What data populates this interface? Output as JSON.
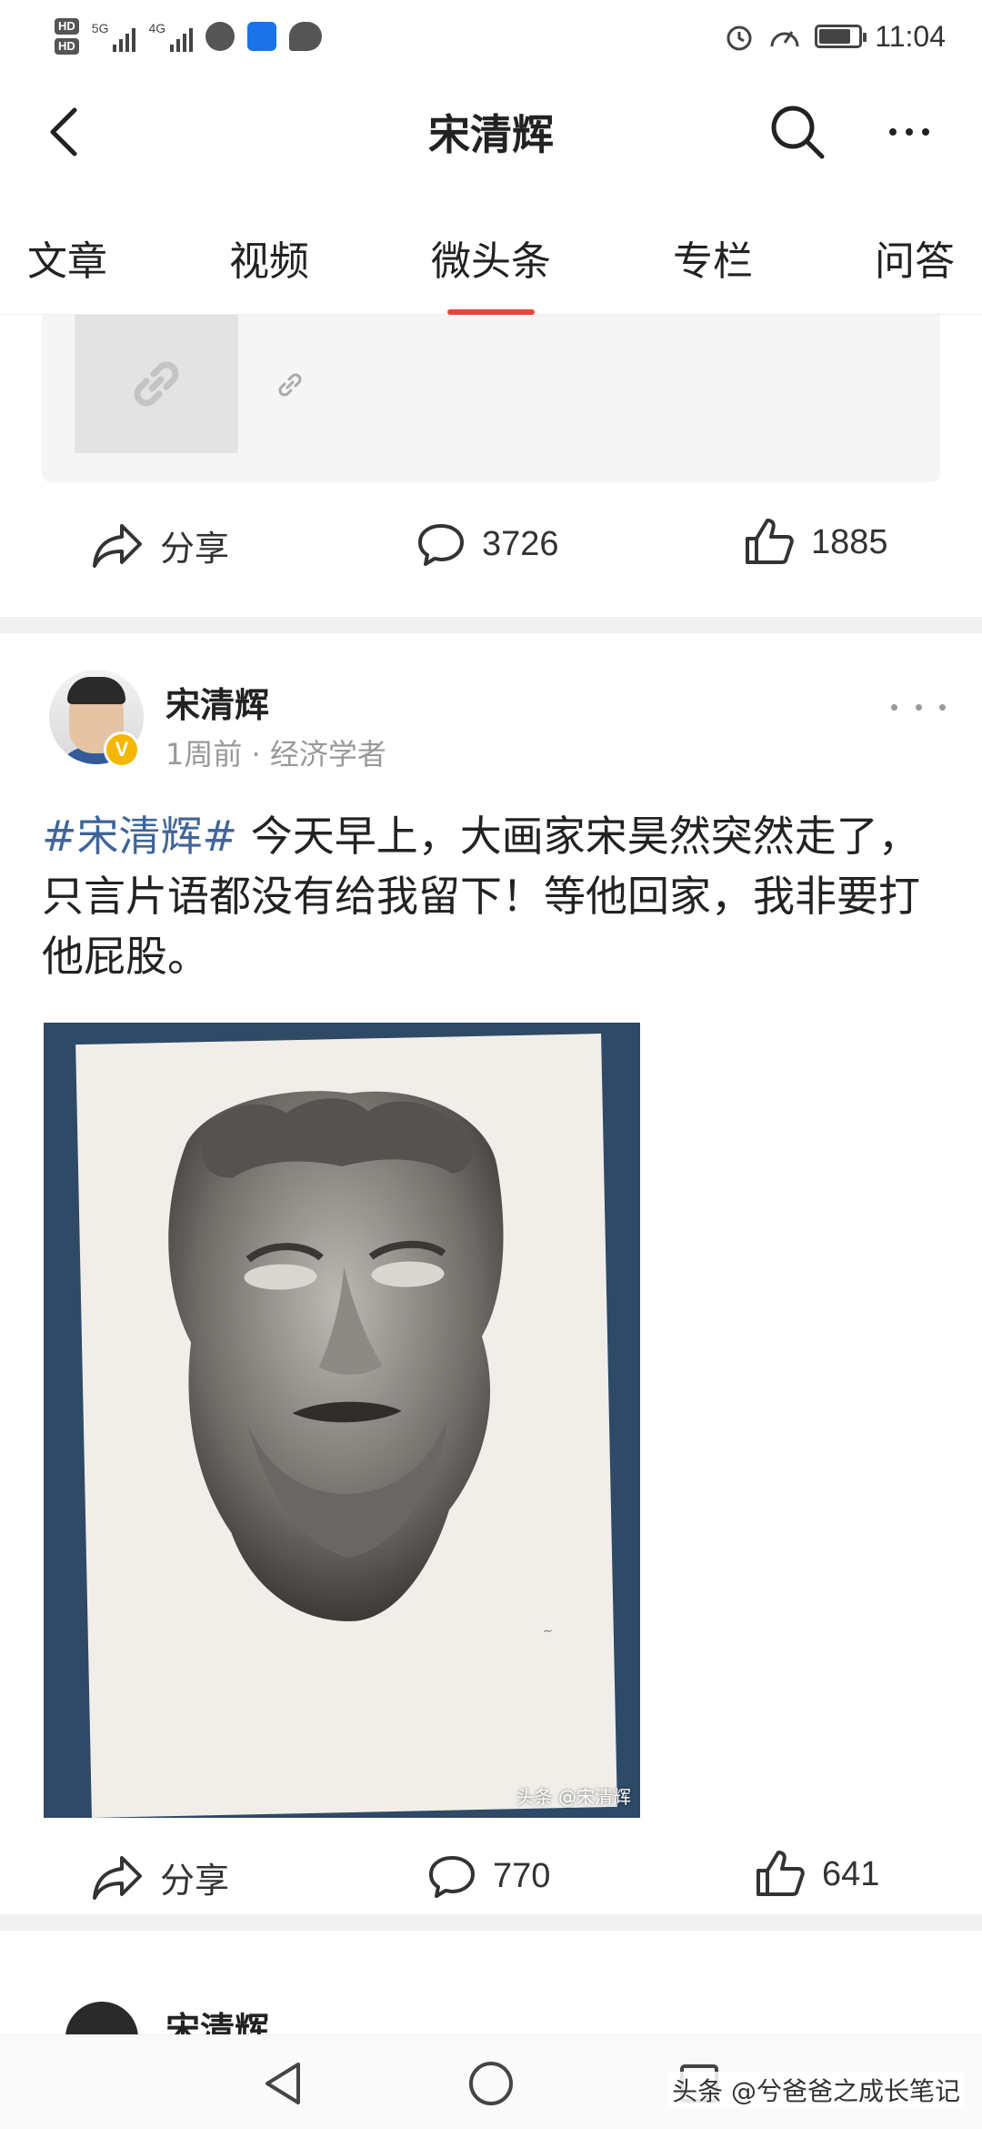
{
  "status_bar": {
    "hd1": "HD",
    "hd2": "HD",
    "net1": "5G",
    "net2": "4G",
    "time": "11:04"
  },
  "header": {
    "title": "宋清辉"
  },
  "tabs": [
    {
      "label": "文章"
    },
    {
      "label": "视频"
    },
    {
      "label": "微头条"
    },
    {
      "label": "专栏"
    },
    {
      "label": "问答"
    }
  ],
  "active_tab": "微头条",
  "prev_post": {
    "share_label": "分享",
    "comments": "3726",
    "likes": "1885"
  },
  "post": {
    "author": "宋清辉",
    "meta": "1周前 · 经济学者",
    "badge": "V",
    "hashtag": "#宋清辉#",
    "text": " 今天早上，大画家宋昊然突然走了，只言片语都没有给我留下！等他回家，我非要打他屁股。",
    "image_watermark": "头条 @宋清辉",
    "share_label": "分享",
    "comments": "770",
    "likes": "641"
  },
  "next_post": {
    "author": "宋清辉"
  },
  "overlay_watermark": "头条 @兮爸爸之成长笔记",
  "colors": {
    "accent": "#e8453c",
    "hashtag": "#406599",
    "badge": "#f5b700"
  },
  "icons": [
    "back-arrow-icon",
    "search-icon",
    "more-icon",
    "link-icon",
    "share-icon",
    "comment-icon",
    "like-icon",
    "nav-back-icon",
    "nav-home-icon",
    "nav-recent-icon"
  ]
}
